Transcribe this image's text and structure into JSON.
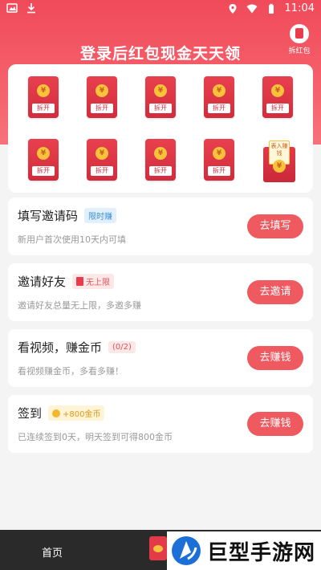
{
  "status_bar": {
    "time": "11:04"
  },
  "header": {
    "title": "登录后红包现金天天领",
    "chai_label": "拆红包"
  },
  "packets": {
    "label": "拆开",
    "coin_symbol": "¥",
    "envelope_text": "表入赚钱"
  },
  "tasks": [
    {
      "title": "填写邀请码",
      "badge": "限时赚",
      "desc": "新用户首次使用10天内可填",
      "button": "去填写"
    },
    {
      "title": "邀请好友",
      "badge": "无上限",
      "desc": "邀请好友总量无上限，多邀多赚",
      "button": "去邀请"
    },
    {
      "title": "看视频，赚金币",
      "badge": "(0/2)",
      "desc": "看视频赚金币，多看多赚！",
      "button": "去赚钱"
    },
    {
      "title": "签到",
      "badge": "+800金币",
      "desc": "已连续签到0天，明天签到可得800金币",
      "button": "去赚钱"
    }
  ],
  "bottom_nav": {
    "home": "首页"
  },
  "watermark": {
    "text": "巨型手游网"
  },
  "colors": {
    "header_red": "#f04a5a",
    "button_red": "#ee5a60",
    "packet_red": "#d22c3c"
  }
}
